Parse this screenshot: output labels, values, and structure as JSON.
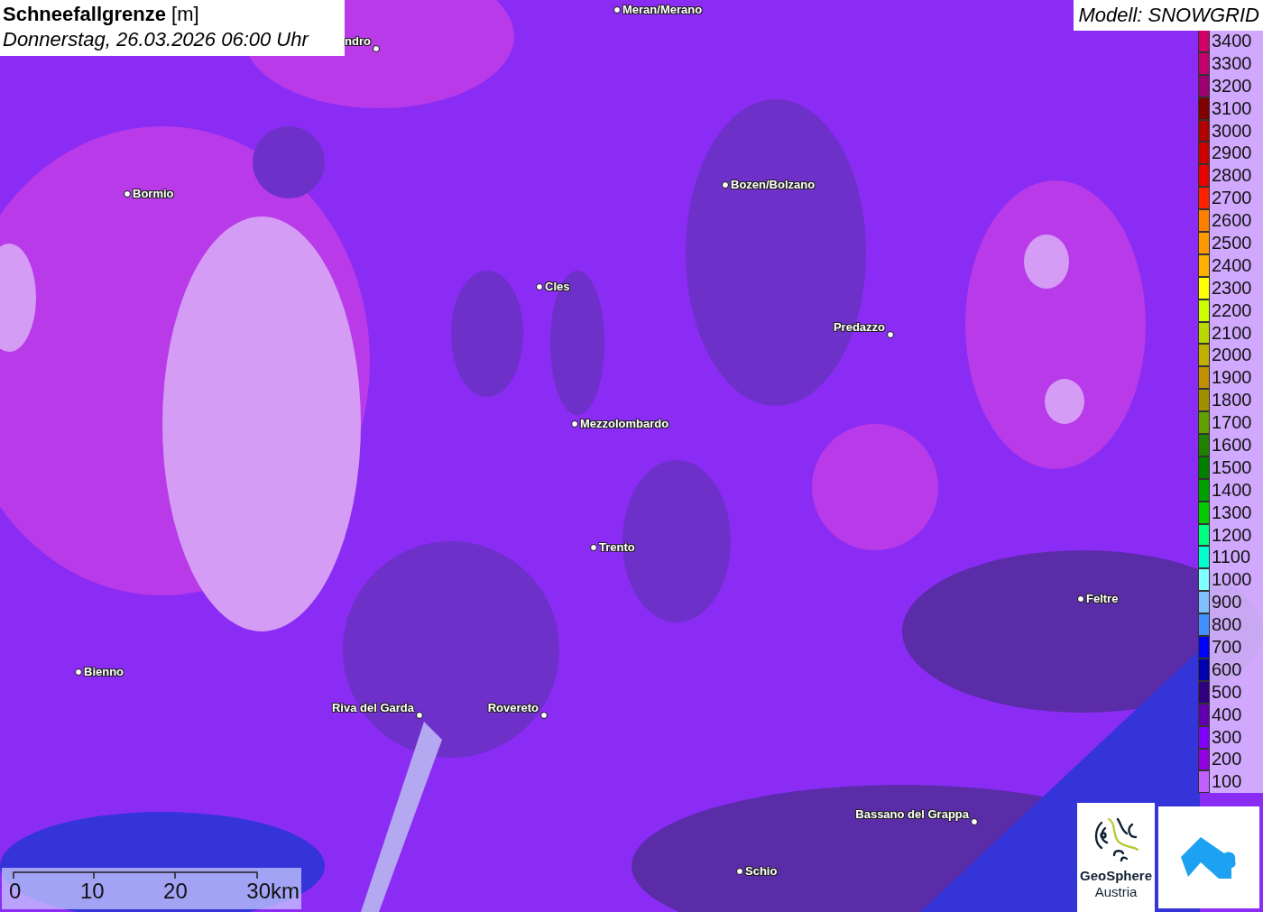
{
  "title": {
    "name": "Schneefallgrenze",
    "unit": "[m]",
    "date": "Donnerstag, 26.03.2026 06:00 Uhr"
  },
  "model": "Modell: SNOWGRID",
  "cities": [
    {
      "name": "Meran/Merano"
    },
    {
      "name": "ndro"
    },
    {
      "name": "Bormio"
    },
    {
      "name": "Bozen/Bolzano"
    },
    {
      "name": "Cles"
    },
    {
      "name": "Predazzo"
    },
    {
      "name": "Mezzolombardo"
    },
    {
      "name": "Trento"
    },
    {
      "name": "Feltre"
    },
    {
      "name": "Bienno"
    },
    {
      "name": "Riva del Garda"
    },
    {
      "name": "Rovereto"
    },
    {
      "name": "Bassano del Grappa"
    },
    {
      "name": "Schio"
    }
  ],
  "legend": [
    {
      "label": "3400",
      "color": "#d4006a"
    },
    {
      "label": "3300",
      "color": "#c4006e"
    },
    {
      "label": "3200",
      "color": "#9c0070"
    },
    {
      "label": "3100",
      "color": "#800000"
    },
    {
      "label": "3000",
      "color": "#b00000"
    },
    {
      "label": "2900",
      "color": "#cc0000"
    },
    {
      "label": "2800",
      "color": "#e60000"
    },
    {
      "label": "2700",
      "color": "#ff2000"
    },
    {
      "label": "2600",
      "color": "#ff8000"
    },
    {
      "label": "2500",
      "color": "#ff9900"
    },
    {
      "label": "2400",
      "color": "#ffb000"
    },
    {
      "label": "2300",
      "color": "#ffff00"
    },
    {
      "label": "2200",
      "color": "#ccff00"
    },
    {
      "label": "2100",
      "color": "#b8d800"
    },
    {
      "label": "2000",
      "color": "#c0b000"
    },
    {
      "label": "1900",
      "color": "#c09000"
    },
    {
      "label": "1800",
      "color": "#a09000"
    },
    {
      "label": "1700",
      "color": "#60a000"
    },
    {
      "label": "1600",
      "color": "#208000"
    },
    {
      "label": "1500",
      "color": "#008000"
    },
    {
      "label": "1400",
      "color": "#00a000"
    },
    {
      "label": "1300",
      "color": "#00cc00"
    },
    {
      "label": "1200",
      "color": "#00ff80"
    },
    {
      "label": "1100",
      "color": "#00ffcc"
    },
    {
      "label": "1000",
      "color": "#80ffff"
    },
    {
      "label": "900",
      "color": "#80c0ff"
    },
    {
      "label": "800",
      "color": "#4090ff"
    },
    {
      "label": "700",
      "color": "#0000ff"
    },
    {
      "label": "600",
      "color": "#0000b0"
    },
    {
      "label": "500",
      "color": "#300080"
    },
    {
      "label": "400",
      "color": "#6000b0"
    },
    {
      "label": "300",
      "color": "#8000ff"
    },
    {
      "label": "200",
      "color": "#9000e0"
    },
    {
      "label": "100",
      "color": "#c060ff"
    }
  ],
  "scale": [
    "0",
    "10",
    "20",
    "30km"
  ],
  "logo": {
    "name": "GeoSphere",
    "sub": "Austria"
  }
}
